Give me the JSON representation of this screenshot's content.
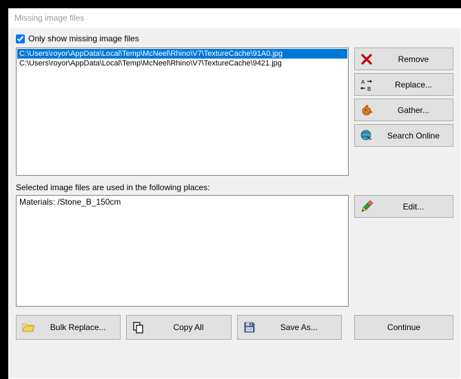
{
  "window": {
    "title": "Missing image files"
  },
  "checkbox": {
    "label": "Only show missing image files",
    "checked": true
  },
  "file_list": {
    "items": [
      {
        "path": "C:\\Users\\royor\\AppData\\Local\\Temp\\McNeel\\Rhino\\V7\\TextureCache\\91A0.jpg",
        "selected": true
      },
      {
        "path": "C:\\Users\\royor\\AppData\\Local\\Temp\\McNeel\\Rhino\\V7\\TextureCache\\9421.jpg",
        "selected": false
      }
    ]
  },
  "side": {
    "remove": "Remove",
    "replace": "Replace...",
    "gather": "Gather...",
    "search_online": "Search Online"
  },
  "usage": {
    "label": "Selected image files are used in the following places:",
    "items": [
      "Materials: /Stone_B_150cm"
    ],
    "edit": "Edit..."
  },
  "bottom": {
    "bulk_replace": "Bulk Replace...",
    "copy_all": "Copy All",
    "save_as": "Save As...",
    "continue": "Continue"
  }
}
